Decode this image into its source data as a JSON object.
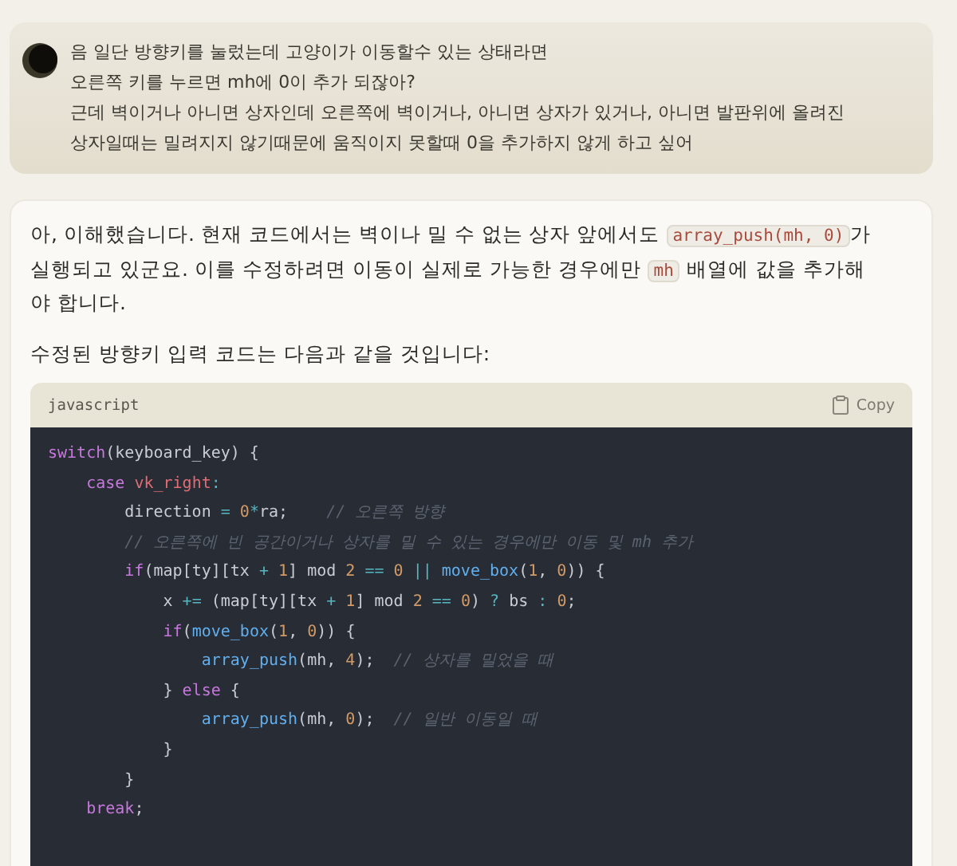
{
  "user_message": {
    "lines": [
      "음 일단 방향키를 눌렀는데 고양이가 이동할수 있는 상태라면",
      "오른쪽 키를 누르면 mh에 0이 추가 되잖아?",
      "근데 벽이거나 아니면 상자인데 오른쪽에 벽이거나, 아니면 상자가 있거나, 아니면 발판위에 올려진",
      "상자일때는 밀려지지 않기때문에 움직이지 못할때 0을 추가하지 않게 하고 싶어"
    ]
  },
  "assistant_message": {
    "paragraphs": [
      [
        {
          "text": "아, 이해했습니다. 현재 코드에서는 벽이나 밀 수 없는 상자 앞에서도 ",
          "kind": "text"
        },
        {
          "text": "array_push(mh, 0)",
          "kind": "code"
        },
        {
          "text": "가 실행되고 있군요. 이를 수정하려면 이동이 실제로 가능한 경우에만 ",
          "kind": "text"
        },
        {
          "text": "mh",
          "kind": "code"
        },
        {
          "text": " 배열에 값을 추가해야 합니다.",
          "kind": "text"
        }
      ],
      [
        {
          "text": "수정된 방향키 입력 코드는 다음과 같을 것입니다:",
          "kind": "text"
        }
      ]
    ],
    "code_block": {
      "language": "javascript",
      "copy_label": "Copy",
      "lines": [
        [
          {
            "text": "switch",
            "kind": "kw"
          },
          {
            "text": "(keyboard_key) {",
            "kind": "plain"
          }
        ],
        [
          {
            "text": "    case",
            "kind": "kw"
          },
          {
            "text": " vk_right",
            "kind": "var"
          },
          {
            "text": ":",
            "kind": "op"
          }
        ],
        [
          {
            "text": "        direction ",
            "kind": "plain"
          },
          {
            "text": "=",
            "kind": "op"
          },
          {
            "text": " 0",
            "kind": "num"
          },
          {
            "text": "*",
            "kind": "op"
          },
          {
            "text": "ra;    ",
            "kind": "plain"
          },
          {
            "text": "// 오른쪽 방향",
            "kind": "comment"
          }
        ],
        [
          {
            "text": "        // 오른쪽에 빈 공간이거나 상자를 밀 수 있는 경우에만 이동 및 mh 추가",
            "kind": "comment"
          }
        ],
        [
          {
            "text": "        if",
            "kind": "kw"
          },
          {
            "text": "(map[ty][tx ",
            "kind": "plain"
          },
          {
            "text": "+",
            "kind": "op"
          },
          {
            "text": " 1",
            "kind": "num"
          },
          {
            "text": "] mod ",
            "kind": "plain"
          },
          {
            "text": "2",
            "kind": "num"
          },
          {
            "text": " ==",
            "kind": "op"
          },
          {
            "text": " 0",
            "kind": "num"
          },
          {
            "text": " ||",
            "kind": "op"
          },
          {
            "text": " move_box",
            "kind": "fn"
          },
          {
            "text": "(",
            "kind": "plain"
          },
          {
            "text": "1",
            "kind": "num"
          },
          {
            "text": ", ",
            "kind": "plain"
          },
          {
            "text": "0",
            "kind": "num"
          },
          {
            "text": ")) {",
            "kind": "plain"
          }
        ],
        [
          {
            "text": "            x ",
            "kind": "plain"
          },
          {
            "text": "+=",
            "kind": "op"
          },
          {
            "text": " (map[ty][tx ",
            "kind": "plain"
          },
          {
            "text": "+",
            "kind": "op"
          },
          {
            "text": " 1",
            "kind": "num"
          },
          {
            "text": "] mod ",
            "kind": "plain"
          },
          {
            "text": "2",
            "kind": "num"
          },
          {
            "text": " ==",
            "kind": "op"
          },
          {
            "text": " 0",
            "kind": "num"
          },
          {
            "text": ") ",
            "kind": "plain"
          },
          {
            "text": "?",
            "kind": "op"
          },
          {
            "text": " bs ",
            "kind": "plain"
          },
          {
            "text": ":",
            "kind": "op"
          },
          {
            "text": " 0",
            "kind": "num"
          },
          {
            "text": ";",
            "kind": "plain"
          }
        ],
        [
          {
            "text": "            if",
            "kind": "kw"
          },
          {
            "text": "(",
            "kind": "plain"
          },
          {
            "text": "move_box",
            "kind": "fn"
          },
          {
            "text": "(",
            "kind": "plain"
          },
          {
            "text": "1",
            "kind": "num"
          },
          {
            "text": ", ",
            "kind": "plain"
          },
          {
            "text": "0",
            "kind": "num"
          },
          {
            "text": ")) {",
            "kind": "plain"
          }
        ],
        [
          {
            "text": "                array_push",
            "kind": "fn"
          },
          {
            "text": "(mh, ",
            "kind": "plain"
          },
          {
            "text": "4",
            "kind": "num"
          },
          {
            "text": ");  ",
            "kind": "plain"
          },
          {
            "text": "// 상자를 밀었을 때",
            "kind": "comment"
          }
        ],
        [
          {
            "text": "            } ",
            "kind": "plain"
          },
          {
            "text": "else",
            "kind": "kw"
          },
          {
            "text": " {",
            "kind": "plain"
          }
        ],
        [
          {
            "text": "                array_push",
            "kind": "fn"
          },
          {
            "text": "(mh, ",
            "kind": "plain"
          },
          {
            "text": "0",
            "kind": "num"
          },
          {
            "text": ");  ",
            "kind": "plain"
          },
          {
            "text": "// 일반 이동일 때",
            "kind": "comment"
          }
        ],
        [
          {
            "text": "            }",
            "kind": "plain"
          }
        ],
        [
          {
            "text": "        }",
            "kind": "plain"
          }
        ],
        [
          {
            "text": "    break",
            "kind": "kw"
          },
          {
            "text": ";",
            "kind": "plain"
          }
        ]
      ]
    }
  }
}
